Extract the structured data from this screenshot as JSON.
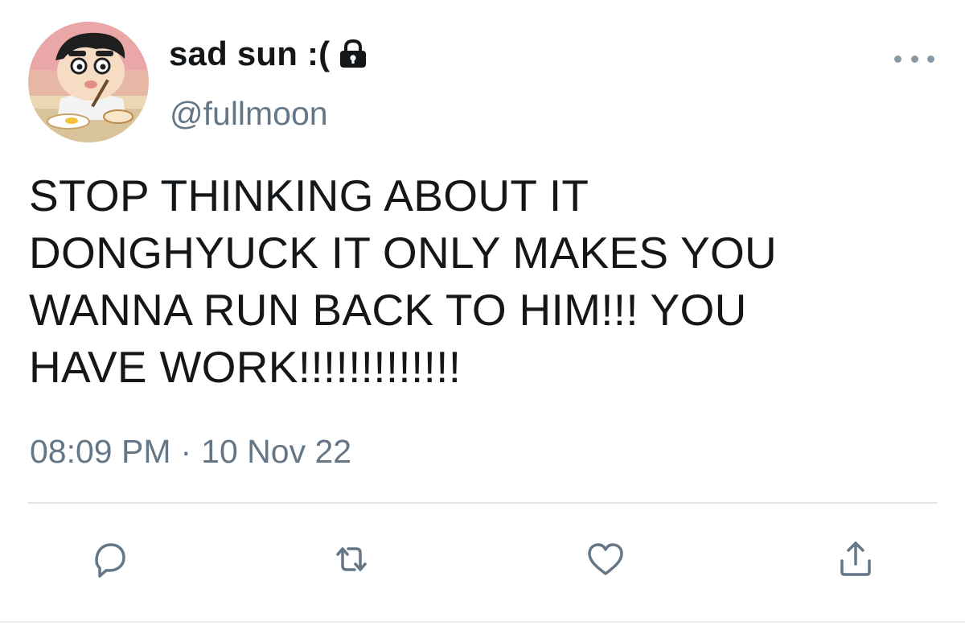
{
  "tweet": {
    "author": {
      "display_name": "sad sun :(",
      "handle": "@fullmoon",
      "protected": true
    },
    "text": "STOP THINKING ABOUT IT\nDONGHYUCK IT ONLY MAKES YOU\nWANNA RUN BACK TO HIM!!! YOU\nHAVE WORK!!!!!!!!!!!!!",
    "time": "08:09 PM",
    "separator": "·",
    "date": "10 Nov 22"
  },
  "icons": {
    "avatar": "avatar-image",
    "lock": "lock-icon",
    "more": "more-options-icon",
    "reply": "reply-icon",
    "retweet": "retweet-icon",
    "like": "like-icon",
    "share": "share-icon"
  },
  "colors": {
    "text": "#14171a",
    "secondary": "#657786",
    "icon": "#657786",
    "divider": "#e1e8ed",
    "background": "#ffffff"
  }
}
